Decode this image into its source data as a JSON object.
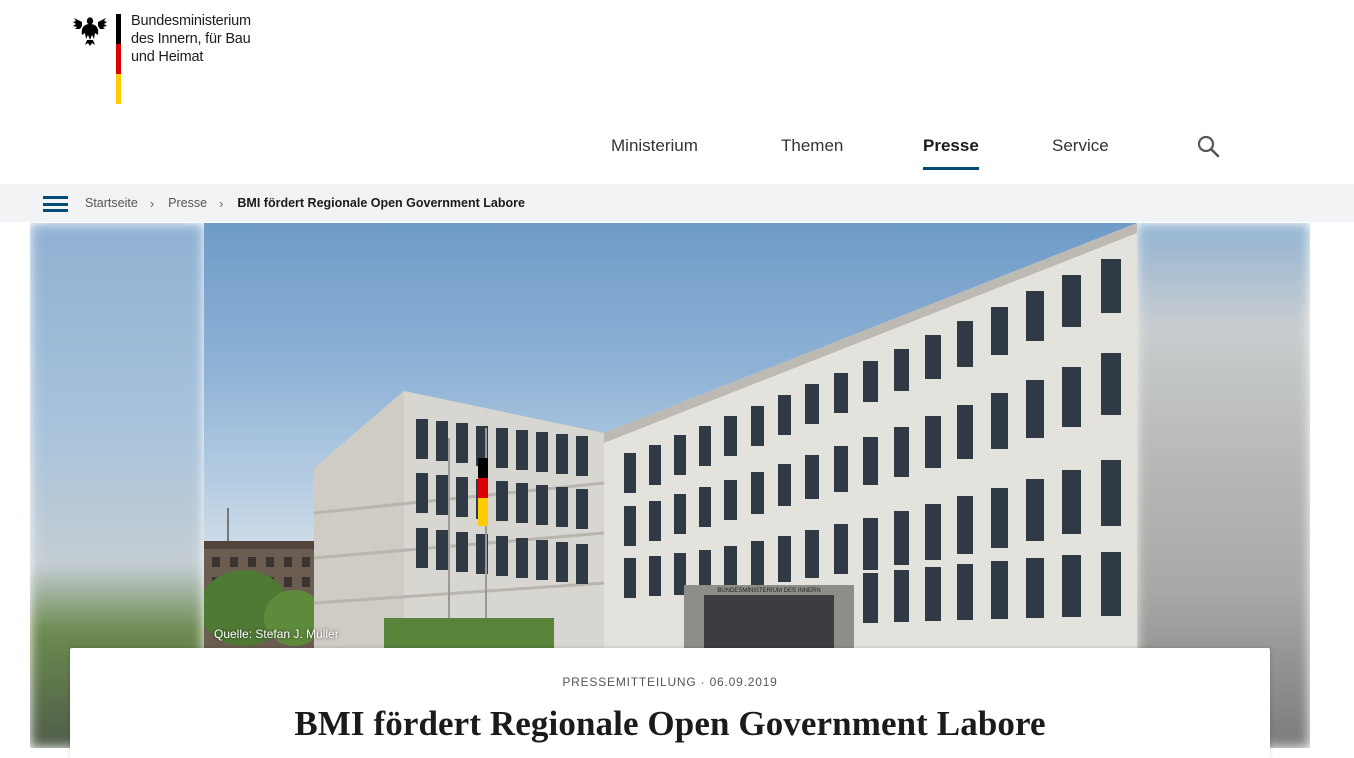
{
  "header": {
    "ministry_line1": "Bundesministerium",
    "ministry_line2": "des Innern, für Bau",
    "ministry_line3": "und Heimat"
  },
  "nav": {
    "items": [
      {
        "label": "Ministerium",
        "active": false
      },
      {
        "label": "Themen",
        "active": false
      },
      {
        "label": "Presse",
        "active": true
      },
      {
        "label": "Service",
        "active": false
      }
    ],
    "search_icon": "search-icon",
    "accent_color": "#004b76"
  },
  "breadcrumb": {
    "menu_icon": "hamburger-icon",
    "items": [
      "Startseite",
      "Presse"
    ],
    "current": "BMI fördert Regionale Open Government Labore"
  },
  "hero": {
    "caption": "Quelle: Stefan J. Müller",
    "sign_text": "BUNDESMINISTERIUM DES INNERN"
  },
  "article": {
    "meta": "PRESSEMITTEILUNG · 06.09.2019",
    "title": "BMI fördert Regionale Open Government Labore"
  }
}
